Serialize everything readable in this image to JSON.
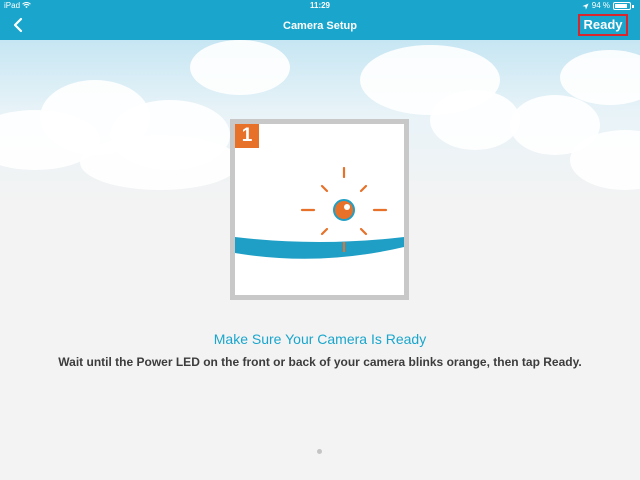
{
  "status_bar": {
    "device": "iPad",
    "time": "11:29",
    "battery": "94 %"
  },
  "nav": {
    "title": "Camera Setup",
    "back_icon": "chevron-left-icon",
    "ready_label": "Ready"
  },
  "step": {
    "number": "1",
    "headline": "Make Sure Your Camera Is Ready",
    "instruction": "Wait until the Power LED on the front or back of your camera blinks orange, then tap Ready."
  },
  "pager": {
    "current": 1,
    "total": 1
  },
  "colors": {
    "brand": "#1aa6cc",
    "accent_orange": "#e8712a",
    "highlight_red": "#d8262c",
    "text_dark": "#3c3c3c"
  }
}
